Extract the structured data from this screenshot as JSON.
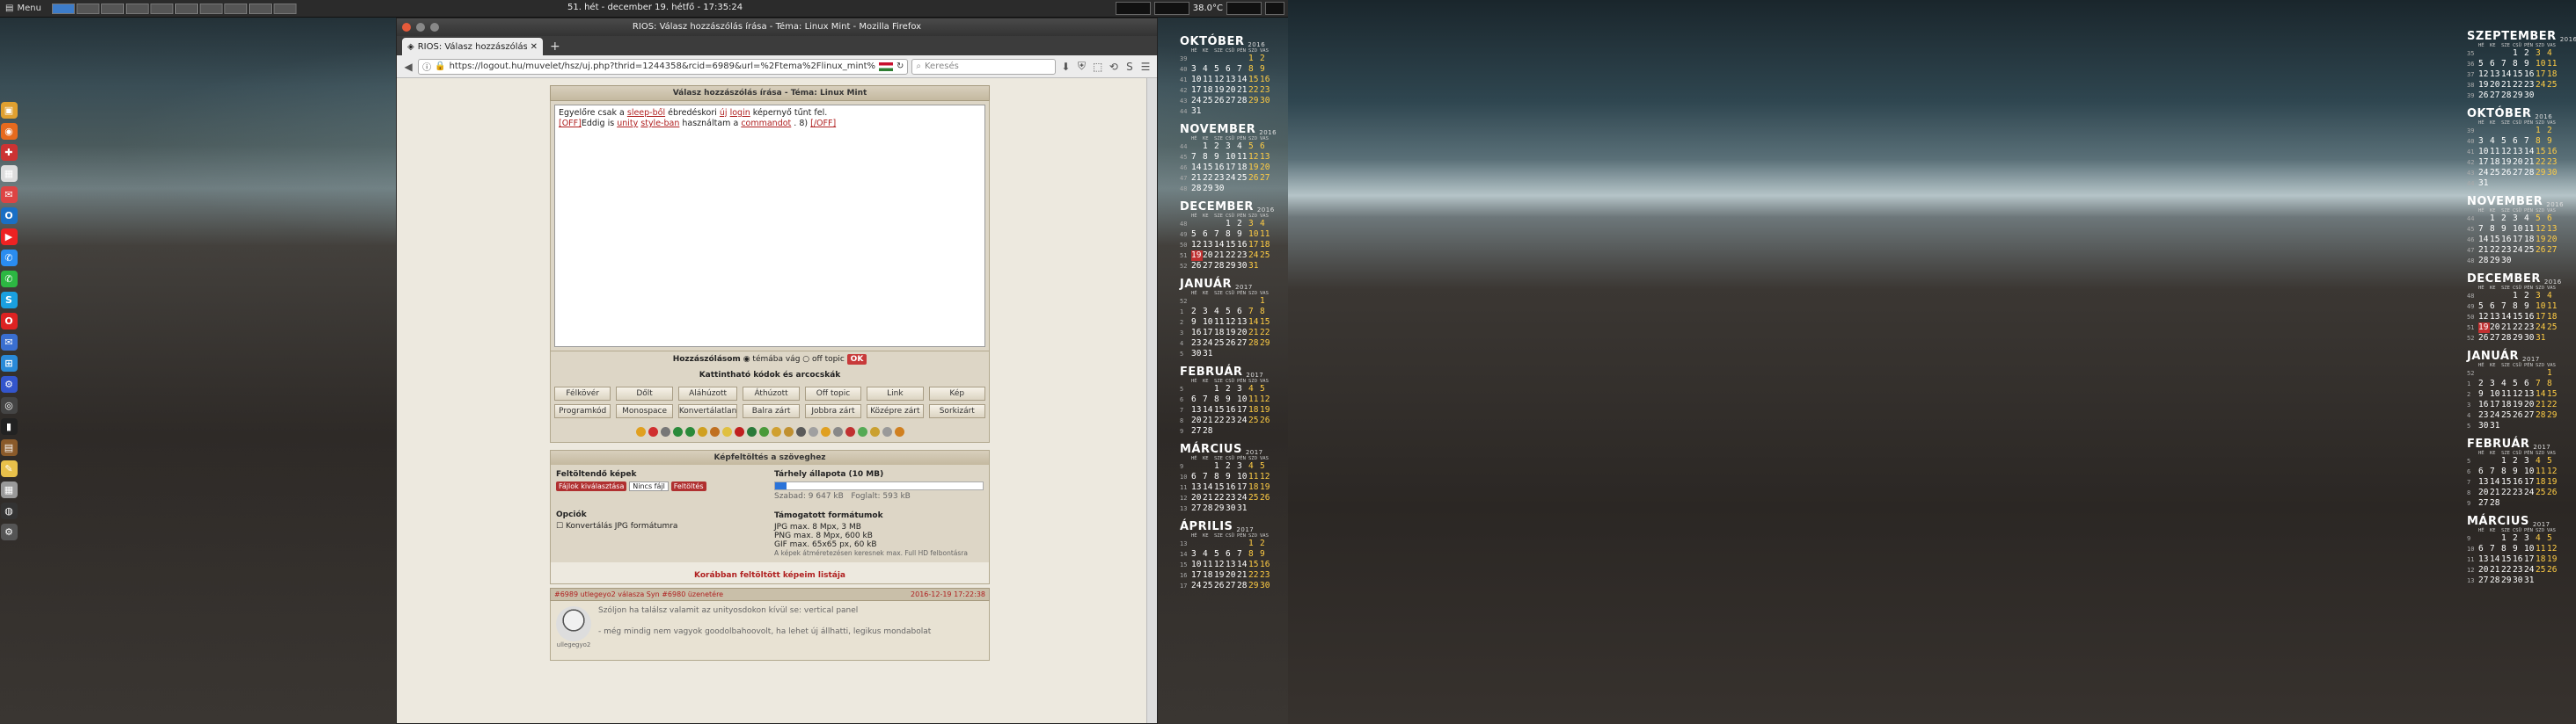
{
  "panel": {
    "menu_label": "Menu",
    "clock": "51. hét - december 19. hétfő - 17:35:24",
    "temperature": "38.0°C"
  },
  "dock": [
    {
      "name": "filemanager-icon",
      "color": "#e0a030",
      "glyph": "▣"
    },
    {
      "name": "firefox-icon",
      "color": "#e66a1e",
      "glyph": "◉"
    },
    {
      "name": "app-red-icon",
      "color": "#c33",
      "glyph": "✚"
    },
    {
      "name": "calendar-icon",
      "color": "#ddd",
      "glyph": "▦"
    },
    {
      "name": "gmail-icon",
      "color": "#d44",
      "glyph": "✉"
    },
    {
      "name": "outlook-icon",
      "color": "#1a6fc4",
      "glyph": "O"
    },
    {
      "name": "youtube-icon",
      "color": "#e22",
      "glyph": "▶"
    },
    {
      "name": "messenger-icon",
      "color": "#2a8cf0",
      "glyph": "✆"
    },
    {
      "name": "whatsapp-icon",
      "color": "#2cb742",
      "glyph": "✆"
    },
    {
      "name": "skype-icon",
      "color": "#1aa0e0",
      "glyph": "S"
    },
    {
      "name": "opera-icon",
      "color": "#d22",
      "glyph": "O"
    },
    {
      "name": "mail-icon",
      "color": "#3a6fd0",
      "glyph": "✉"
    },
    {
      "name": "windows-icon",
      "color": "#2a8ad8",
      "glyph": "⊞"
    },
    {
      "name": "settings-icon",
      "color": "#3355cc",
      "glyph": "⚙"
    },
    {
      "name": "camera-icon",
      "color": "#444",
      "glyph": "◎"
    },
    {
      "name": "terminal-icon",
      "color": "#222",
      "glyph": "▮"
    },
    {
      "name": "archive-icon",
      "color": "#8a5a2a",
      "glyph": "▤"
    },
    {
      "name": "notes-icon",
      "color": "#e8c04a",
      "glyph": "✎"
    },
    {
      "name": "calculator-icon",
      "color": "#999",
      "glyph": "▦"
    },
    {
      "name": "disk-icon",
      "color": "#333",
      "glyph": "◍"
    },
    {
      "name": "gear-icon",
      "color": "#555",
      "glyph": "⚙"
    }
  ],
  "browser": {
    "window_title": "RIOS: Válasz hozzászólás írása - Téma: Linux Mint - Mozilla Firefox",
    "tab_title": "RIOS: Válasz hozzászólás...",
    "url": "https://logout.hu/muvelet/hsz/uj.php?thrid=1244358&rcid=6989&url=%2Ftema%2Flinux_mint%",
    "search_placeholder": "Keresés"
  },
  "forum": {
    "reply_title": "Válasz hozzászólás írása - Téma: Linux Mint",
    "editor_text_1a": "Egyelőre csak a ",
    "editor_link_sleep": "sleep-ből",
    "editor_text_1b": " ébredéskori ",
    "editor_link_uj": "új",
    "editor_link_login": "login",
    "editor_text_1c": " képernyő tűnt fel.",
    "editor_link_off1": "[OFF]",
    "editor_text_2a": "Eddig is ",
    "editor_link_unity": "unity",
    "editor_link_style": "style-ban",
    "editor_text_2b": " használtam a ",
    "editor_link_cmd": "commandot",
    "editor_text_2c": " . 8) ",
    "editor_link_off2": "[/OFF]",
    "post_label": "Hozzászólásom",
    "radio_1": "témába vág",
    "radio_2": "off topic",
    "ok_label": "OK",
    "codes_title": "Kattintható kódok és arcocskák",
    "format_buttons": [
      "Félkövér",
      "Dőlt",
      "Aláhúzott",
      "Áthúzott",
      "Off topic",
      "Link",
      "Kép",
      "Programkód",
      "Monospace",
      "Konvertálatlan",
      "Balra zárt",
      "Jobbra zárt",
      "Középre zárt",
      "Sorkizárt"
    ],
    "upload_title": "Képfeltöltés a szöveghez",
    "upload_images_label": "Feltöltendő képek",
    "choose_file_btn": "Fájlok kiválasztása",
    "no_file": "Nincs fájl",
    "upload_btn": "Feltöltés",
    "options_label": "Opciók",
    "convert_jpg": "Konvertálás JPG formátumra",
    "storage_label": "Tárhely állapota (10 MB)",
    "storage_used_fraction": 0.057,
    "free_label": "Szabad: 9 647 kB",
    "used_label": "Foglalt: 593 kB",
    "formats_title": "Támogatott formátumok",
    "format_jpg": "JPG max. 8 Mpx, 3 MB",
    "format_png": "PNG max. 8 Mpx, 600 kB",
    "format_gif": "GIF max. 65x65 px, 60 kB",
    "format_note": "A képek átméretezésen keresnek max. Full HD felbontásra",
    "older_link": "Korábban feltöltött képeim listája",
    "post_head_left": "#6989 utlegeyo2 válasza Syn #6980 üzenetére",
    "post_head_right": "2016-12-19 17:22:38",
    "post_line_1": "Szóljon ha találsz valamit az unityosdokon kívül se: vertical panel",
    "post_line_2": "- még mindig nem vagyok goodolbahoovolt, ha lehet új állhatti, legikus mondabolat",
    "post_user": "ullegegyo2"
  },
  "cal_dow": [
    "HÉ",
    "KE",
    "SZE",
    "CSÜ",
    "PÉN",
    "SZO",
    "VAS"
  ],
  "calendar_left": [
    {
      "month": "OKTÓBER",
      "year": "2016",
      "weeks": [
        [
          "39",
          "",
          "",
          "",
          "",
          "",
          "1",
          "2"
        ],
        [
          "40",
          "3",
          "4",
          "5",
          "6",
          "7",
          "8",
          "9"
        ],
        [
          "41",
          "10",
          "11",
          "12",
          "13",
          "14",
          "15",
          "16"
        ],
        [
          "42",
          "17",
          "18",
          "19",
          "20",
          "21",
          "22",
          "23"
        ],
        [
          "43",
          "24",
          "25",
          "26",
          "27",
          "28",
          "29",
          "30"
        ],
        [
          "44",
          "31",
          "",
          "",
          "",
          "",
          "",
          ""
        ]
      ]
    },
    {
      "month": "NOVEMBER",
      "year": "2016",
      "weeks": [
        [
          "44",
          "",
          "1",
          "2",
          "3",
          "4",
          "5",
          "6"
        ],
        [
          "45",
          "7",
          "8",
          "9",
          "10",
          "11",
          "12",
          "13"
        ],
        [
          "46",
          "14",
          "15",
          "16",
          "17",
          "18",
          "19",
          "20"
        ],
        [
          "47",
          "21",
          "22",
          "23",
          "24",
          "25",
          "26",
          "27"
        ],
        [
          "48",
          "28",
          "29",
          "30",
          "",
          "",
          "",
          ""
        ]
      ]
    },
    {
      "month": "DECEMBER",
      "year": "2016",
      "weeks": [
        [
          "48",
          "",
          "",
          "",
          "1",
          "2",
          "3",
          "4"
        ],
        [
          "49",
          "5",
          "6",
          "7",
          "8",
          "9",
          "10",
          "11"
        ],
        [
          "50",
          "12",
          "13",
          "14",
          "15",
          "16",
          "17",
          "18"
        ],
        [
          "51",
          "19",
          "20",
          "21",
          "22",
          "23",
          "24",
          "25"
        ],
        [
          "52",
          "26",
          "27",
          "28",
          "29",
          "30",
          "31",
          ""
        ]
      ],
      "today": "19"
    },
    {
      "month": "JANUÁR",
      "year": "2017",
      "weeks": [
        [
          "52",
          "",
          "",
          "",
          "",
          "",
          "",
          "1"
        ],
        [
          "1",
          "2",
          "3",
          "4",
          "5",
          "6",
          "7",
          "8"
        ],
        [
          "2",
          "9",
          "10",
          "11",
          "12",
          "13",
          "14",
          "15"
        ],
        [
          "3",
          "16",
          "17",
          "18",
          "19",
          "20",
          "21",
          "22"
        ],
        [
          "4",
          "23",
          "24",
          "25",
          "26",
          "27",
          "28",
          "29"
        ],
        [
          "5",
          "30",
          "31",
          "",
          "",
          "",
          "",
          ""
        ]
      ]
    },
    {
      "month": "FEBRUÁR",
      "year": "2017",
      "weeks": [
        [
          "5",
          "",
          "",
          "1",
          "2",
          "3",
          "4",
          "5"
        ],
        [
          "6",
          "6",
          "7",
          "8",
          "9",
          "10",
          "11",
          "12"
        ],
        [
          "7",
          "13",
          "14",
          "15",
          "16",
          "17",
          "18",
          "19"
        ],
        [
          "8",
          "20",
          "21",
          "22",
          "23",
          "24",
          "25",
          "26"
        ],
        [
          "9",
          "27",
          "28",
          "",
          "",
          "",
          "",
          ""
        ]
      ]
    },
    {
      "month": "MÁRCIUS",
      "year": "2017",
      "weeks": [
        [
          "9",
          "",
          "",
          "1",
          "2",
          "3",
          "4",
          "5"
        ],
        [
          "10",
          "6",
          "7",
          "8",
          "9",
          "10",
          "11",
          "12"
        ],
        [
          "11",
          "13",
          "14",
          "15",
          "16",
          "17",
          "18",
          "19"
        ],
        [
          "12",
          "20",
          "21",
          "22",
          "23",
          "24",
          "25",
          "26"
        ],
        [
          "13",
          "27",
          "28",
          "29",
          "30",
          "31",
          "",
          ""
        ]
      ]
    },
    {
      "month": "ÁPRILIS",
      "year": "2017",
      "weeks": [
        [
          "13",
          "",
          "",
          "",
          "",
          "",
          "1",
          "2"
        ],
        [
          "14",
          "3",
          "4",
          "5",
          "6",
          "7",
          "8",
          "9"
        ],
        [
          "15",
          "10",
          "11",
          "12",
          "13",
          "14",
          "15",
          "16"
        ],
        [
          "16",
          "17",
          "18",
          "19",
          "20",
          "21",
          "22",
          "23"
        ],
        [
          "17",
          "24",
          "25",
          "26",
          "27",
          "28",
          "29",
          "30"
        ]
      ]
    }
  ],
  "calendar_right": [
    {
      "month": "SZEPTEMBER",
      "year": "2016",
      "weeks": [
        [
          "35",
          "",
          "",
          "",
          "1",
          "2",
          "3",
          "4"
        ],
        [
          "36",
          "5",
          "6",
          "7",
          "8",
          "9",
          "10",
          "11"
        ],
        [
          "37",
          "12",
          "13",
          "14",
          "15",
          "16",
          "17",
          "18"
        ],
        [
          "38",
          "19",
          "20",
          "21",
          "22",
          "23",
          "24",
          "25"
        ],
        [
          "39",
          "26",
          "27",
          "28",
          "29",
          "30",
          "",
          ""
        ]
      ]
    },
    {
      "month": "OKTÓBER",
      "year": "2016",
      "weeks": [
        [
          "39",
          "",
          "",
          "",
          "",
          "",
          "1",
          "2"
        ],
        [
          "40",
          "3",
          "4",
          "5",
          "6",
          "7",
          "8",
          "9"
        ],
        [
          "41",
          "10",
          "11",
          "12",
          "13",
          "14",
          "15",
          "16"
        ],
        [
          "42",
          "17",
          "18",
          "19",
          "20",
          "21",
          "22",
          "23"
        ],
        [
          "43",
          "24",
          "25",
          "26",
          "27",
          "28",
          "29",
          "30"
        ],
        [
          "44",
          "31",
          "",
          "",
          "",
          "",
          "",
          ""
        ]
      ]
    },
    {
      "month": "NOVEMBER",
      "year": "2016",
      "weeks": [
        [
          "44",
          "",
          "1",
          "2",
          "3",
          "4",
          "5",
          "6"
        ],
        [
          "45",
          "7",
          "8",
          "9",
          "10",
          "11",
          "12",
          "13"
        ],
        [
          "46",
          "14",
          "15",
          "16",
          "17",
          "18",
          "19",
          "20"
        ],
        [
          "47",
          "21",
          "22",
          "23",
          "24",
          "25",
          "26",
          "27"
        ],
        [
          "48",
          "28",
          "29",
          "30",
          "",
          "",
          "",
          ""
        ]
      ]
    },
    {
      "month": "DECEMBER",
      "year": "2016",
      "weeks": [
        [
          "48",
          "",
          "",
          "",
          "1",
          "2",
          "3",
          "4"
        ],
        [
          "49",
          "5",
          "6",
          "7",
          "8",
          "9",
          "10",
          "11"
        ],
        [
          "50",
          "12",
          "13",
          "14",
          "15",
          "16",
          "17",
          "18"
        ],
        [
          "51",
          "19",
          "20",
          "21",
          "22",
          "23",
          "24",
          "25"
        ],
        [
          "52",
          "26",
          "27",
          "28",
          "29",
          "30",
          "31",
          ""
        ]
      ],
      "today": "19"
    },
    {
      "month": "JANUÁR",
      "year": "2017",
      "weeks": [
        [
          "52",
          "",
          "",
          "",
          "",
          "",
          "",
          "1"
        ],
        [
          "1",
          "2",
          "3",
          "4",
          "5",
          "6",
          "7",
          "8"
        ],
        [
          "2",
          "9",
          "10",
          "11",
          "12",
          "13",
          "14",
          "15"
        ],
        [
          "3",
          "16",
          "17",
          "18",
          "19",
          "20",
          "21",
          "22"
        ],
        [
          "4",
          "23",
          "24",
          "25",
          "26",
          "27",
          "28",
          "29"
        ],
        [
          "5",
          "30",
          "31",
          "",
          "",
          "",
          "",
          ""
        ]
      ]
    },
    {
      "month": "FEBRUÁR",
      "year": "2017",
      "weeks": [
        [
          "5",
          "",
          "",
          "1",
          "2",
          "3",
          "4",
          "5"
        ],
        [
          "6",
          "6",
          "7",
          "8",
          "9",
          "10",
          "11",
          "12"
        ],
        [
          "7",
          "13",
          "14",
          "15",
          "16",
          "17",
          "18",
          "19"
        ],
        [
          "8",
          "20",
          "21",
          "22",
          "23",
          "24",
          "25",
          "26"
        ],
        [
          "9",
          "27",
          "28",
          "",
          "",
          "",
          "",
          ""
        ]
      ]
    },
    {
      "month": "MÁRCIUS",
      "year": "2017",
      "weeks": [
        [
          "9",
          "",
          "",
          "1",
          "2",
          "3",
          "4",
          "5"
        ],
        [
          "10",
          "6",
          "7",
          "8",
          "9",
          "10",
          "11",
          "12"
        ],
        [
          "11",
          "13",
          "14",
          "15",
          "16",
          "17",
          "18",
          "19"
        ],
        [
          "12",
          "20",
          "21",
          "22",
          "23",
          "24",
          "25",
          "26"
        ],
        [
          "13",
          "27",
          "28",
          "29",
          "30",
          "31",
          "",
          ""
        ]
      ]
    }
  ],
  "colors": {
    "accent_red": "#c03030",
    "weekend": "#ffcc44",
    "progress": "#2a73d9"
  }
}
